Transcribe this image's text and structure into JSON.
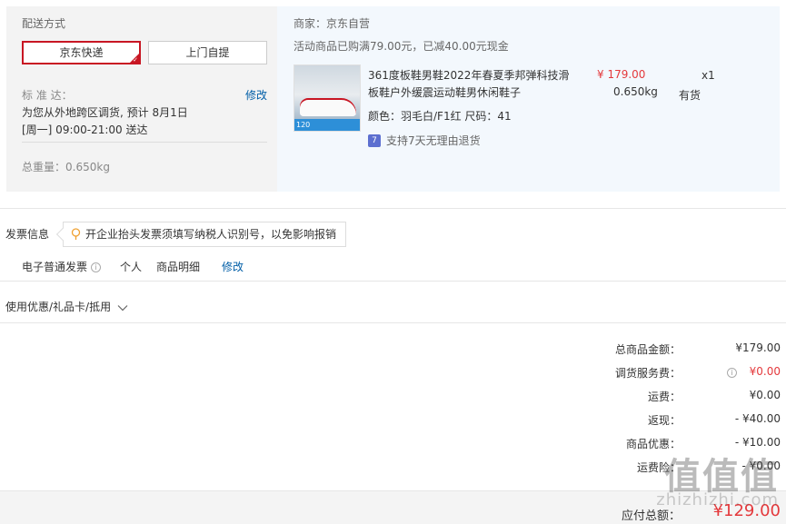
{
  "shipping": {
    "title": "配送方式",
    "option_selected": "京东快递",
    "option_other": "上门自提",
    "standard_label": "标 准 达：",
    "modify": "修改",
    "line1": "为您从外地跨区调货, 预计 8月1日",
    "line2": "[周一] 09:00-21:00 送达",
    "weight_label": "总重量：",
    "weight_value": "0.650kg"
  },
  "store": {
    "merchant": "商家：京东自营",
    "promo": "活动商品已购满79.00元，已减40.00元现金",
    "image_badge": "120",
    "product_name_line1": "361度板鞋男鞋2022年春夏季邦弹科技滑",
    "product_name_line2": "板鞋户外缓震运动鞋男休闲鞋子",
    "price": "¥ 179.00",
    "quantity": "x1",
    "weight": "0.650kg",
    "stock": "有货",
    "attributes": "颜色：羽毛白/F1红  尺码：41",
    "return_icon": "7",
    "return_policy": "支持7天无理由退货"
  },
  "invoice": {
    "title": "发票信息",
    "tip": "开企业抬头发票须填写纳税人识别号，以免影响报销",
    "type": "电子普通发票",
    "info_icon": "i",
    "person": "个人",
    "detail": "商品明细",
    "modify": "修改"
  },
  "coupon": {
    "label": "使用优惠/礼品卡/抵用"
  },
  "summary": {
    "rows": [
      {
        "label": "总商品金额：",
        "value": "¥179.00"
      },
      {
        "label": "调货服务费：",
        "value": "¥0.00"
      },
      {
        "label": "运费：",
        "value": "¥0.00"
      },
      {
        "label": "返现：",
        "value": "- ¥40.00"
      },
      {
        "label": "商品优惠：",
        "value": "- ¥10.00"
      },
      {
        "label": "运费险：",
        "value": "- ¥0.00"
      }
    ],
    "total_label": "应付总额：",
    "total_value": "¥129.00"
  },
  "watermark": {
    "main": "值值值",
    "sub": "zhizhizhi.com"
  },
  "colors": {
    "accent_red": "#e4393c",
    "link_blue": "#005ea7",
    "fee_orange": "#e4393c"
  }
}
